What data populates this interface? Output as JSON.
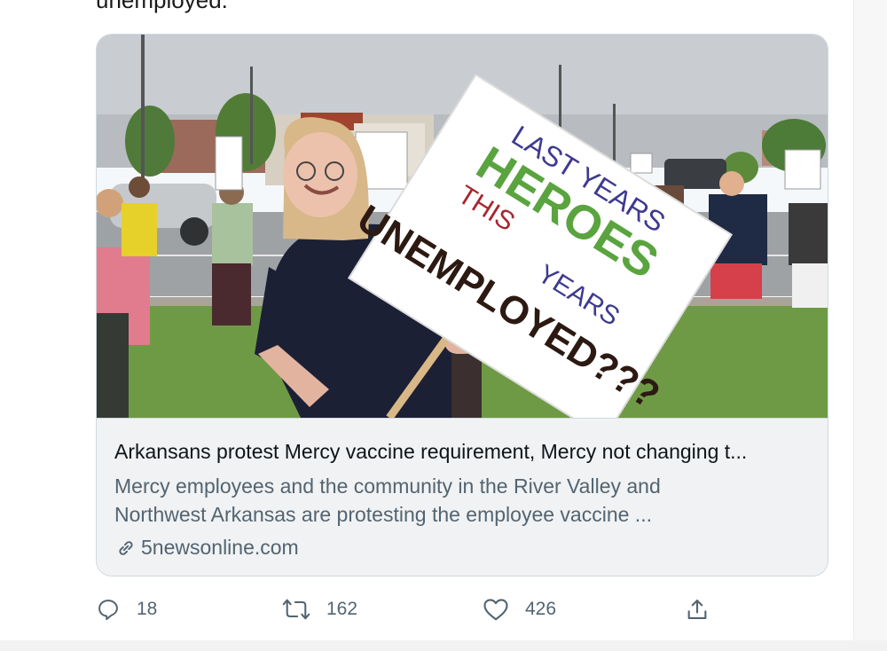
{
  "tweet": {
    "prev_text": "unemployed."
  },
  "card": {
    "image_sign": {
      "line1": "LAST YEARS",
      "line2": "HEROES",
      "line3": "THIS",
      "line4": "YEARS",
      "line5": "UNEMPLOYED???"
    },
    "title": "Arkansans protest Mercy vaccine requirement, Mercy not changing t...",
    "description": "Mercy employees and the community in the River Valley and Northwest Arkansas are protesting the employee vaccine ...",
    "domain": "5newsonline.com"
  },
  "actions": {
    "reply_count": "18",
    "retweet_count": "162",
    "like_count": "426"
  },
  "colors": {
    "sky": "#c9ccd1",
    "grass": "#6f9a45",
    "muted_text": "#536471",
    "card_border": "#cfd9de"
  },
  "icons": [
    "link-icon",
    "reply-icon",
    "retweet-icon",
    "like-icon",
    "share-icon"
  ]
}
